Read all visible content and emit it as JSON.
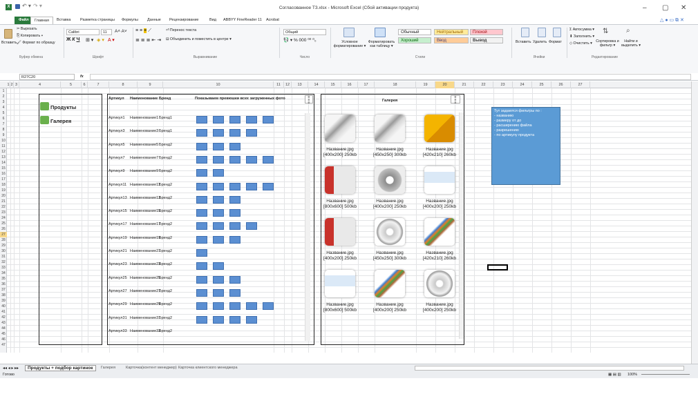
{
  "window": {
    "title": "Согласованное ТЗ.xlsx - Microsoft Excel (Сбой активации продукта)"
  },
  "tabs": [
    "Файл",
    "Главная",
    "Вставка",
    "Разметка страницы",
    "Формулы",
    "Данные",
    "Рецензирование",
    "Вид",
    "ABBYY FineReader 11",
    "Acrobat"
  ],
  "ribbon": {
    "clipboard": {
      "cut": "Вырезать",
      "copy": "Копировать ▾",
      "format_painter": "Формат по образцу",
      "paste": "Вставить",
      "group": "Буфер обмена"
    },
    "font": {
      "name": "Calibri",
      "size": "11",
      "group": "Шрифт"
    },
    "alignment": {
      "wrap": "Перенос текста",
      "merge": "Объединить и поместить в центре ▾",
      "group": "Выравнивание"
    },
    "number": {
      "format": "Общий",
      "group": "Число"
    },
    "styles": {
      "conditional": "Условное форматирование ▾",
      "as_table": "Форматировать как таблицу ▾",
      "normal": "Обычный",
      "neutral": "Нейтральный",
      "bad": "Плохой",
      "good": "Хороший",
      "input": "Ввод",
      "output": "Вывод",
      "group": "Стили"
    },
    "cells": {
      "insert": "Вставить",
      "delete": "Удалить",
      "format": "Формат",
      "group": "Ячейки"
    },
    "editing": {
      "autosum": "Автосумма ▾",
      "fill": "Заполнить ▾",
      "clear": "Очистить ▾",
      "sort": "Сортировка и фильтр ▾",
      "find": "Найти и выделить ▾",
      "group": "Редактирование"
    }
  },
  "formula_bar": {
    "name_box": "R27C20",
    "fx": "fx",
    "value": ""
  },
  "columns": [
    {
      "label": "1",
      "w": 5
    },
    {
      "label": "2",
      "w": 5
    },
    {
      "label": "3",
      "w": 8
    },
    {
      "label": "4",
      "w": 60
    },
    {
      "label": "5",
      "w": 30
    },
    {
      "label": "6",
      "w": 9
    },
    {
      "label": "7",
      "w": 31
    },
    {
      "label": "8",
      "w": 41
    },
    {
      "label": "9",
      "w": 37
    },
    {
      "label": "10",
      "w": 160
    },
    {
      "label": "11",
      "w": 15
    },
    {
      "label": "12",
      "w": 11
    },
    {
      "label": "13",
      "w": 24
    },
    {
      "label": "14",
      "w": 24
    },
    {
      "label": "15",
      "w": 24
    },
    {
      "label": "16",
      "w": 24
    },
    {
      "label": "17",
      "w": 24
    },
    {
      "label": "18",
      "w": 60
    },
    {
      "label": "19",
      "w": 28
    },
    {
      "label": "20",
      "w": 28
    },
    {
      "label": "21",
      "w": 28
    },
    {
      "label": "22",
      "w": 28
    },
    {
      "label": "23",
      "w": 28
    },
    {
      "label": "24",
      "w": 28
    },
    {
      "label": "25",
      "w": 28
    },
    {
      "label": "26",
      "w": 28
    },
    {
      "label": "27",
      "w": 28
    }
  ],
  "selected_column": "20",
  "selected_row": "27",
  "left_menu": [
    "Продукты",
    "Галерея"
  ],
  "table": {
    "headers": [
      "Артикул",
      "Наименование",
      "Бренд",
      "Показываем превюшки всех загруженных фото"
    ],
    "rows": [
      {
        "article": "Артикул1",
        "name": "Наименование1",
        "brand": "Бренд1",
        "previews": 5
      },
      {
        "article": "Артикул3",
        "name": "Наименование3",
        "brand": "Бренд1",
        "previews": 4
      },
      {
        "article": "Артикул5",
        "name": "Наименование5",
        "brand": "Бренд2",
        "previews": 3
      },
      {
        "article": "Артикул7",
        "name": "Наименование7",
        "brand": "Бренд2",
        "previews": 5
      },
      {
        "article": "Артикул9",
        "name": "Наименование9",
        "brand": "Бренд2",
        "previews": 2
      },
      {
        "article": "Артикул11",
        "name": "Наименование11",
        "brand": "Бренд2",
        "previews": 5
      },
      {
        "article": "Артикул13",
        "name": "Наименование13",
        "brand": "Бренд2",
        "previews": 3
      },
      {
        "article": "Артикул15",
        "name": "Наименование15",
        "brand": "Бренд2",
        "previews": 3
      },
      {
        "article": "Артикул17",
        "name": "Наименование17",
        "brand": "Бренд2",
        "previews": 4
      },
      {
        "article": "Артикул19",
        "name": "Наименование19",
        "brand": "Бренд2",
        "previews": 3
      },
      {
        "article": "Артикул21",
        "name": "Наименование21",
        "brand": "Бренд2",
        "previews": 1
      },
      {
        "article": "Артикул23",
        "name": "Наименование23",
        "brand": "Бренд2",
        "previews": 2
      },
      {
        "article": "Артикул25",
        "name": "Наименование25",
        "brand": "Бренд2",
        "previews": 3
      },
      {
        "article": "Артикул27",
        "name": "Наименование27",
        "brand": "Бренд2",
        "previews": 3
      },
      {
        "article": "Артикул29",
        "name": "Наименование29",
        "brand": "Бренд2",
        "previews": 5
      },
      {
        "article": "Артикул31",
        "name": "Наименование31",
        "brand": "Бренд2",
        "previews": 4
      },
      {
        "article": "Артикул33",
        "name": "Наименование33",
        "brand": "Бренд2",
        "previews": 0
      }
    ]
  },
  "gallery": {
    "title": "Галерея",
    "items": [
      {
        "name": "Название.jpg",
        "meta": "[400x200] 250kb",
        "img": "cable-grey"
      },
      {
        "name": "Название.jpg",
        "meta": "[450x250] 300kb",
        "img": "cable-grey"
      },
      {
        "name": "Название.jpg",
        "meta": "[420x210] 260kb",
        "img": "box-yellow"
      },
      {
        "name": "Название.jpg",
        "meta": "[800x600] 500kb",
        "img": "box-red"
      },
      {
        "name": "Название.jpg",
        "meta": "[400x200] 250kb",
        "img": "coil-grey"
      },
      {
        "name": "Название.jpg",
        "meta": "[400x200] 250kb",
        "img": "label-blue"
      },
      {
        "name": "Название.jpg",
        "meta": "[400x200] 250kb",
        "img": "box-red"
      },
      {
        "name": "Название.jpg",
        "meta": "[450x250] 300kb",
        "img": "coil-white"
      },
      {
        "name": "Название.jpg",
        "meta": "[420x210] 260kb",
        "img": "cable-color"
      },
      {
        "name": "Название.jpg",
        "meta": "[800x600] 500kb",
        "img": "label-blue"
      },
      {
        "name": "Название.jpg",
        "meta": "[400x200] 250kb",
        "img": "cable-color"
      },
      {
        "name": "Название.jpg",
        "meta": "[400x200] 250kb",
        "img": "coil-white"
      }
    ]
  },
  "note": {
    "lines": [
      "Тут задаются фильтры по :",
      "- названию",
      "- размеру от до",
      "- расширению файла",
      "- разрешению",
      "- по артикулу продукта"
    ]
  },
  "sheet_tabs": [
    "Продукты + подбор картинок",
    "Галерея",
    "Карточка(контент менеджер)",
    "Карточка клиентского менеджера"
  ],
  "status": {
    "ready": "Готово",
    "zoom": "100%"
  },
  "colors": {
    "accent": "#2a7a3c",
    "green_button": "#6ab04c",
    "preview_blue": "#5b8fd2",
    "note_bg": "#5b9bd5",
    "selected_header": "#f8d88a"
  }
}
